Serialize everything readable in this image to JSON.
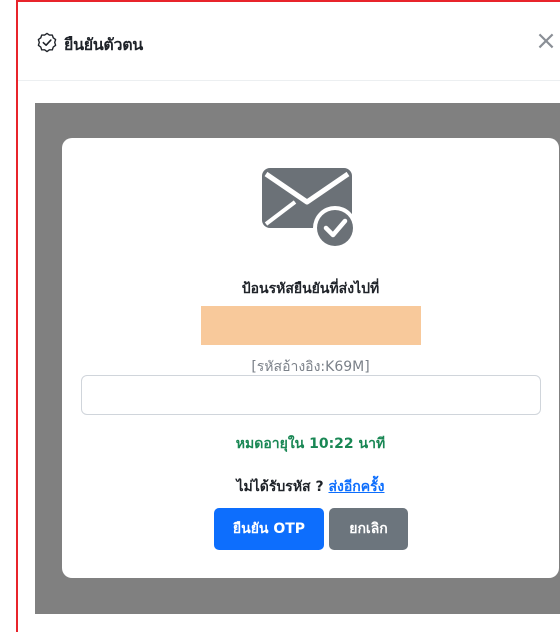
{
  "dialog": {
    "title": "ยืนยันตัวตน",
    "close_label": "×"
  },
  "otp": {
    "prompt": "ป้อนรหัสยืนยันที่ส่งไปที่",
    "reference": "[รหัสอ้างอิง:K69M]",
    "input_value": "",
    "input_placeholder": "",
    "expiry_text": "หมดอายุใน 10:22 นาที",
    "resend_question": "ไม่ได้รับรหัส ?",
    "resend_link": "ส่งอีกครั้ง",
    "confirm_button": "ยืนยัน OTP",
    "cancel_button": "ยกเลิก"
  },
  "icons": {
    "header": "shield-check-icon",
    "envelope": "envelope-check-icon",
    "close": "close-icon"
  },
  "colors": {
    "primary": "#0d6efd",
    "secondary": "#6c757d",
    "success": "#198754",
    "masked_highlight": "#f8c99b",
    "overlay": "#808080"
  }
}
